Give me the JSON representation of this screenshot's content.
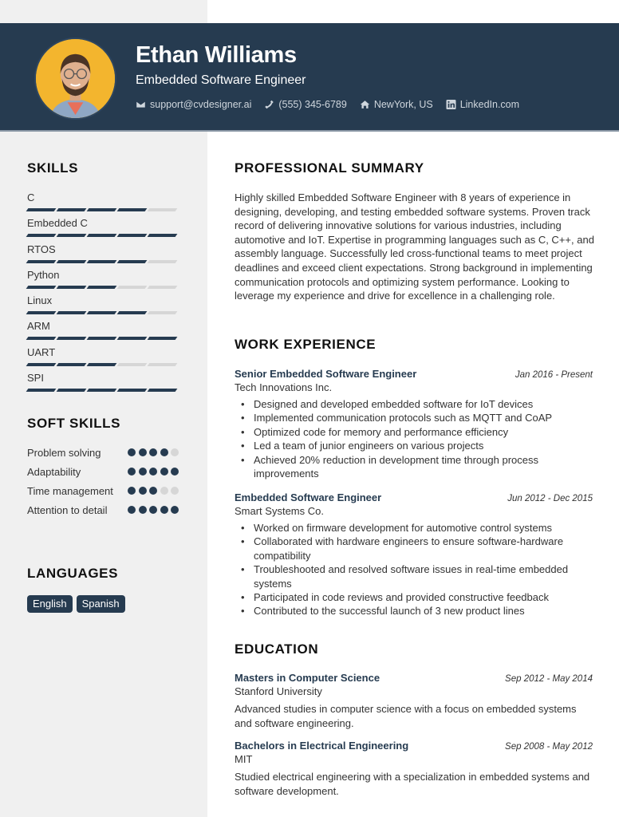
{
  "header": {
    "name": "Ethan Williams",
    "title": "Embedded Software Engineer",
    "photo_icon": "avatar-photo",
    "contacts": [
      {
        "icon": "envelope-icon",
        "text": "support@cvdesigner.ai"
      },
      {
        "icon": "phone-icon",
        "text": "(555) 345-6789"
      },
      {
        "icon": "home-icon",
        "text": "NewYork, US"
      },
      {
        "icon": "linkedin-icon",
        "text": "LinkedIn.com"
      }
    ]
  },
  "colors": {
    "primary": "#263b50",
    "sidebar": "#f0f0f0",
    "inactive": "#d6d6d6"
  },
  "sidebar": {
    "skills_title": "SKILLS",
    "skills": [
      {
        "name": "C",
        "level": 4,
        "max": 5
      },
      {
        "name": "Embedded C",
        "level": 5,
        "max": 5
      },
      {
        "name": "RTOS",
        "level": 4,
        "max": 5
      },
      {
        "name": "Python",
        "level": 3,
        "max": 5
      },
      {
        "name": "Linux",
        "level": 4,
        "max": 5
      },
      {
        "name": "ARM",
        "level": 5,
        "max": 5
      },
      {
        "name": "UART",
        "level": 3,
        "max": 5
      },
      {
        "name": "SPI",
        "level": 5,
        "max": 5
      }
    ],
    "soft_skills_title": "SOFT SKILLS",
    "soft_skills": [
      {
        "name": "Problem solving",
        "level": 4,
        "max": 5
      },
      {
        "name": "Adaptability",
        "level": 5,
        "max": 5
      },
      {
        "name": "Time management",
        "level": 3,
        "max": 5
      },
      {
        "name": "Attention to detail",
        "level": 5,
        "max": 5
      }
    ],
    "languages_title": "LANGUAGES",
    "languages": [
      "English",
      "Spanish"
    ]
  },
  "main": {
    "summary_title": "PROFESSIONAL SUMMARY",
    "summary": "Highly skilled Embedded Software Engineer with 8 years of experience in designing, developing, and testing embedded software systems. Proven track record of delivering innovative solutions for various industries, including automotive and IoT. Expertise in programming languages such as C, C++, and assembly language. Successfully led cross-functional teams to meet project deadlines and exceed client expectations. Strong background in implementing communication protocols and optimizing system performance. Looking to leverage my experience and drive for excellence in a challenging role.",
    "experience_title": "WORK EXPERIENCE",
    "experience": [
      {
        "role": "Senior Embedded Software Engineer",
        "dates": "Jan 2016 - Present",
        "company": "Tech Innovations Inc.",
        "bullets": [
          "Designed and developed embedded software for IoT devices",
          "Implemented communication protocols such as MQTT and CoAP",
          "Optimized code for memory and performance efficiency",
          "Led a team of junior engineers on various projects",
          "Achieved 20% reduction in development time through process improvements"
        ]
      },
      {
        "role": "Embedded Software Engineer",
        "dates": "Jun 2012 - Dec 2015",
        "company": "Smart Systems Co.",
        "bullets": [
          "Worked on firmware development for automotive control systems",
          "Collaborated with hardware engineers to ensure software-hardware compatibility",
          "Troubleshooted and resolved software issues in real-time embedded systems",
          "Participated in code reviews and provided constructive feedback",
          "Contributed to the successful launch of 3 new product lines"
        ]
      }
    ],
    "education_title": "EDUCATION",
    "education": [
      {
        "degree": "Masters in Computer Science",
        "dates": "Sep 2012 - May 2014",
        "school": "Stanford University",
        "description": "Advanced studies in computer science with a focus on embedded systems and software engineering."
      },
      {
        "degree": "Bachelors in Electrical Engineering",
        "dates": "Sep 2008 - May 2012",
        "school": "MIT",
        "description": "Studied electrical engineering with a specialization in embedded systems and software development."
      }
    ]
  }
}
